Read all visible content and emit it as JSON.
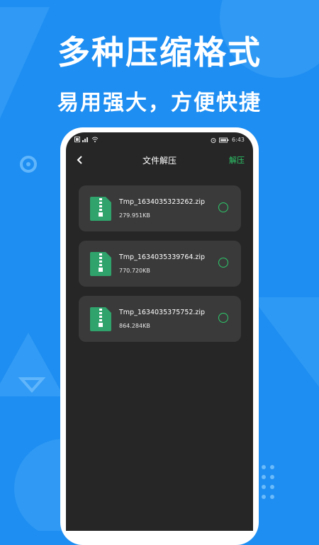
{
  "promo": {
    "headline": "多种压缩格式",
    "subline": "易用强大，方便快捷"
  },
  "status_bar": {
    "time": "6:43",
    "left_icons": [
      "sim-icon",
      "signal-icon",
      "wifi-icon"
    ],
    "right_icons": [
      "alarm-icon",
      "battery-icon"
    ]
  },
  "nav": {
    "back_icon": "chevron-left-icon",
    "title": "文件解压",
    "action": "解压"
  },
  "files": [
    {
      "name": "Tmp_1634035323262.zip",
      "size": "279.951KB",
      "selected": false
    },
    {
      "name": "Tmp_1634035339764.zip",
      "size": "770.720KB",
      "selected": false
    },
    {
      "name": "Tmp_1634035375752.zip",
      "size": "864.284KB",
      "selected": false
    }
  ],
  "colors": {
    "background": "#1e8ef2",
    "screen": "#262626",
    "card": "#3a3a3a",
    "accent": "#2ec96a",
    "zip_icon": "#2fa36b"
  }
}
